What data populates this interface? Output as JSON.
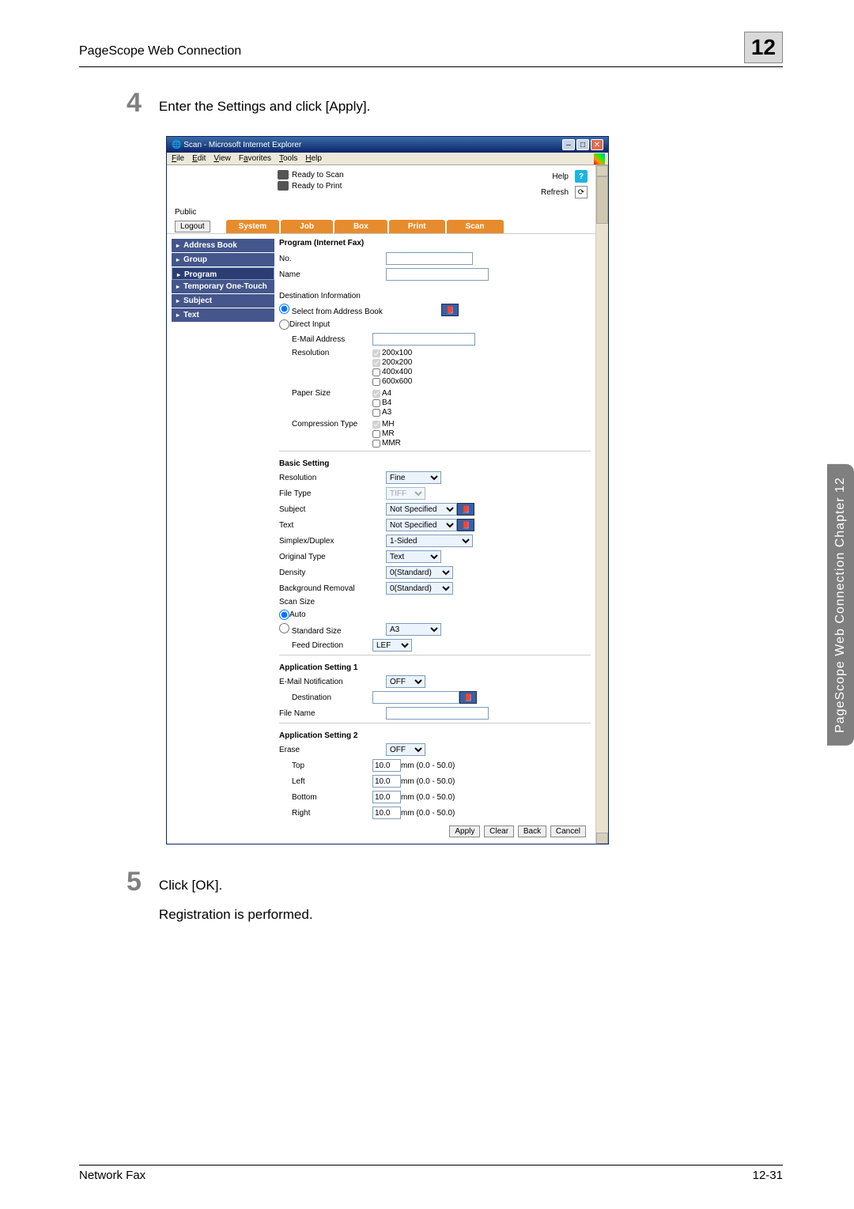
{
  "page": {
    "header": "PageScope Web Connection",
    "chapter_number": "12",
    "step4_num": "4",
    "step4_text": "Enter the Settings and click [Apply].",
    "step5_num": "5",
    "step5_text": "Click [OK].",
    "step5_text2": "Registration is performed.",
    "footer_left": "Network Fax",
    "footer_right": "12-31",
    "side_tab": "PageScope Web Connection     Chapter 12"
  },
  "ie": {
    "title": "Scan - Microsoft Internet Explorer",
    "menu": [
      "File",
      "Edit",
      "View",
      "Favorites",
      "Tools",
      "Help"
    ],
    "ready_scan": "Ready to Scan",
    "ready_print": "Ready to Print",
    "help": "Help",
    "refresh": "Refresh",
    "public": "Public",
    "logout": "Logout",
    "tabs": [
      "System",
      "Job",
      "Box",
      "Print",
      "Scan"
    ]
  },
  "sidebar": {
    "items": [
      "Address Book",
      "Group",
      "Program",
      "Temporary One-Touch",
      "Subject",
      "Text"
    ]
  },
  "form": {
    "title": "Program (Internet Fax)",
    "no": "No.",
    "name": "Name",
    "dest_info": "Destination Information",
    "sel_ab": "Select from Address Book",
    "direct": "Direct Input",
    "email": "E-Mail Address",
    "resolution": "Resolution",
    "res_opts": [
      "200x100",
      "200x200",
      "400x400",
      "600x600"
    ],
    "paper": "Paper Size",
    "paper_opts": [
      "A4",
      "B4",
      "A3"
    ],
    "comp": "Compression Type",
    "comp_opts": [
      "MH",
      "MR",
      "MMR"
    ],
    "basic": "Basic Setting",
    "b_res": "Resolution",
    "b_res_v": "Fine",
    "b_ft": "File Type",
    "b_ft_v": "TIFF",
    "b_sub": "Subject",
    "b_sub_v": "Not Specified",
    "b_text": "Text",
    "b_text_v": "Not Specified",
    "b_sd": "Simplex/Duplex",
    "b_sd_v": "1-Sided",
    "b_ot": "Original Type",
    "b_ot_v": "Text",
    "b_den": "Density",
    "b_den_v": "0(Standard)",
    "b_bg": "Background Removal",
    "b_bg_v": "0(Standard)",
    "b_ss": "Scan Size",
    "b_auto": "Auto",
    "b_std": "Standard Size",
    "b_std_v": "A3",
    "b_feed": "Feed Direction",
    "b_feed_v": "LEF",
    "app1": "Application Setting 1",
    "a_email": "E-Mail Notification",
    "a_email_v": "OFF",
    "a_dest": "Destination",
    "a_fn": "File Name",
    "app2": "Application Setting 2",
    "a_erase": "Erase",
    "a_erase_v": "OFF",
    "a_top": "Top",
    "a_left": "Left",
    "a_bottom": "Bottom",
    "a_right": "Right",
    "mm_val": "10.0",
    "mm_unit": "mm (0.0 - 50.0)",
    "btns": [
      "Apply",
      "Clear",
      "Back",
      "Cancel"
    ]
  }
}
